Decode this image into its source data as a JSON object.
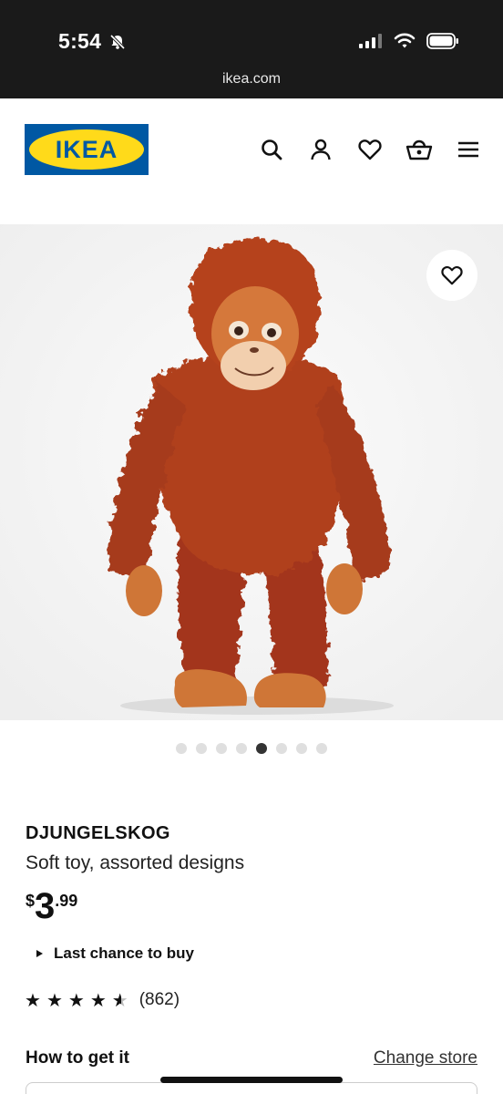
{
  "status_bar": {
    "time": "5:54",
    "url": "ikea.com"
  },
  "header": {
    "logo_text": "IKEA",
    "logo_colors": {
      "background": "#0058A3",
      "oval": "#FFDA1A"
    },
    "icons": [
      "search-icon",
      "user-icon",
      "heart-icon",
      "basket-icon",
      "menu-icon"
    ]
  },
  "gallery": {
    "dot_count": 8,
    "active_index": 4
  },
  "product": {
    "name": "DJUNGELSKOG",
    "description": "Soft toy, assorted designs",
    "price_currency": "$",
    "price_integer": "3",
    "price_decimal": ".99",
    "last_chance": "Last chance to buy",
    "rating_stars": 4.5,
    "review_count": "(862)"
  },
  "availability": {
    "title": "How to get it",
    "change_store": "Change store"
  }
}
